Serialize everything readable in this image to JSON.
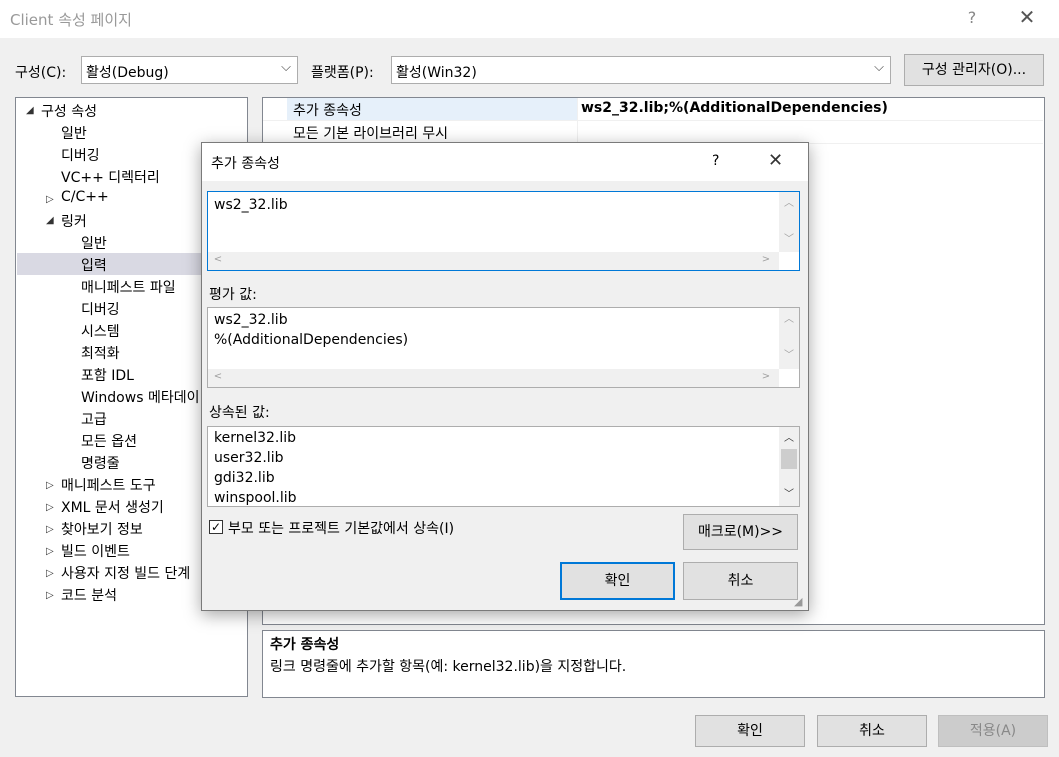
{
  "window": {
    "title": "Client 속성 페이지",
    "help_glyph": "?",
    "close_glyph": "✕"
  },
  "toolbar": {
    "config_label": "구성(C):",
    "config_value": "활성(Debug)",
    "platform_label": "플랫폼(P):",
    "platform_value": "활성(Win32)",
    "config_manager_button": "구성 관리자(O)..."
  },
  "tree": {
    "root": "구성 속성",
    "items_l1": [
      "일반",
      "디버깅",
      "VC++ 디렉터리"
    ],
    "cpp": "C/C++",
    "linker": "링커",
    "linker_children": [
      "일반",
      "입력",
      "매니페스트 파일",
      "디버깅",
      "시스템",
      "최적화",
      "포함 IDL",
      "Windows 메타데이",
      "고급",
      "모든 옵션",
      "명령줄"
    ],
    "items_after": [
      "매니페스트 도구",
      "XML 문서 생성기",
      "찾아보기 정보",
      "빌드 이벤트",
      "사용자 지정 빌드 단계",
      "코드 분석"
    ]
  },
  "grid": {
    "rows": [
      {
        "name": "추가 종속성",
        "value": "ws2_32.lib;%(AdditionalDependencies)"
      },
      {
        "name": "모든 기본 라이브러리 무시",
        "value": ""
      }
    ]
  },
  "description": {
    "title": "추가 종속성",
    "text": "링크 명령줄에 추가할 항목(예: kernel32.lib)을 지정합니다."
  },
  "footer": {
    "ok": "확인",
    "cancel": "취소",
    "apply": "적용(A)"
  },
  "dialog": {
    "title": "추가 종속성",
    "help_glyph": "?",
    "close_glyph": "✕",
    "input_value": "ws2_32.lib",
    "evaluated_label": "평가 값:",
    "evaluated_lines": [
      "ws2_32.lib",
      "%(AdditionalDependencies)"
    ],
    "inherited_label": "상속된 값:",
    "inherited_lines": [
      "kernel32.lib",
      "user32.lib",
      "gdi32.lib",
      "winspool.lib"
    ],
    "inherit_checkbox": "부모 또는 프로젝트 기본값에서 상속(I)",
    "inherit_checked": true,
    "macro_button": "매크로(M)>>",
    "ok": "확인",
    "cancel": "취소"
  },
  "colors": {
    "accent": "#0078d7",
    "selection": "#cce8ff",
    "tree_selection": "#d9d9e3"
  }
}
